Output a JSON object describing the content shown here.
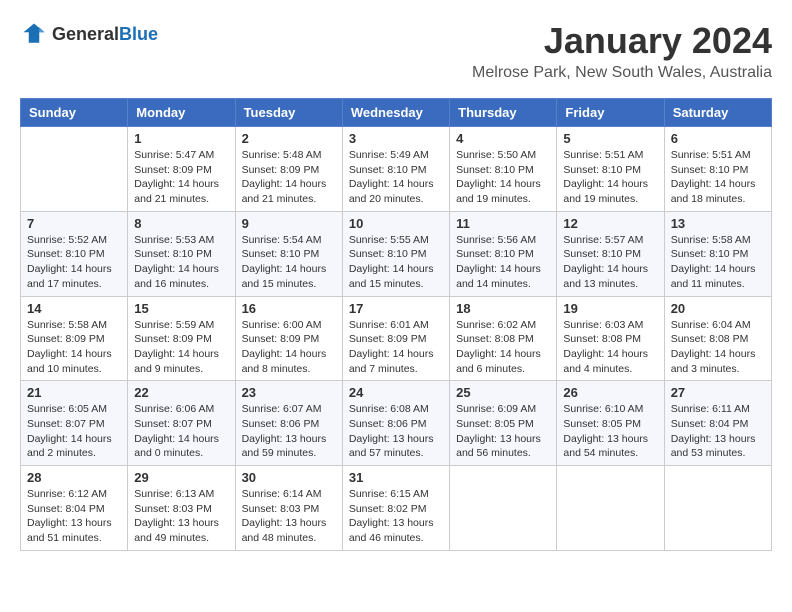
{
  "logo": {
    "general": "General",
    "blue": "Blue"
  },
  "title": {
    "month_year": "January 2024",
    "location": "Melrose Park, New South Wales, Australia"
  },
  "days_of_week": [
    "Sunday",
    "Monday",
    "Tuesday",
    "Wednesday",
    "Thursday",
    "Friday",
    "Saturday"
  ],
  "weeks": [
    [
      {
        "day": "",
        "info": ""
      },
      {
        "day": "1",
        "info": "Sunrise: 5:47 AM\nSunset: 8:09 PM\nDaylight: 14 hours\nand 21 minutes."
      },
      {
        "day": "2",
        "info": "Sunrise: 5:48 AM\nSunset: 8:09 PM\nDaylight: 14 hours\nand 21 minutes."
      },
      {
        "day": "3",
        "info": "Sunrise: 5:49 AM\nSunset: 8:10 PM\nDaylight: 14 hours\nand 20 minutes."
      },
      {
        "day": "4",
        "info": "Sunrise: 5:50 AM\nSunset: 8:10 PM\nDaylight: 14 hours\nand 19 minutes."
      },
      {
        "day": "5",
        "info": "Sunrise: 5:51 AM\nSunset: 8:10 PM\nDaylight: 14 hours\nand 19 minutes."
      },
      {
        "day": "6",
        "info": "Sunrise: 5:51 AM\nSunset: 8:10 PM\nDaylight: 14 hours\nand 18 minutes."
      }
    ],
    [
      {
        "day": "7",
        "info": "Sunrise: 5:52 AM\nSunset: 8:10 PM\nDaylight: 14 hours\nand 17 minutes."
      },
      {
        "day": "8",
        "info": "Sunrise: 5:53 AM\nSunset: 8:10 PM\nDaylight: 14 hours\nand 16 minutes."
      },
      {
        "day": "9",
        "info": "Sunrise: 5:54 AM\nSunset: 8:10 PM\nDaylight: 14 hours\nand 15 minutes."
      },
      {
        "day": "10",
        "info": "Sunrise: 5:55 AM\nSunset: 8:10 PM\nDaylight: 14 hours\nand 15 minutes."
      },
      {
        "day": "11",
        "info": "Sunrise: 5:56 AM\nSunset: 8:10 PM\nDaylight: 14 hours\nand 14 minutes."
      },
      {
        "day": "12",
        "info": "Sunrise: 5:57 AM\nSunset: 8:10 PM\nDaylight: 14 hours\nand 13 minutes."
      },
      {
        "day": "13",
        "info": "Sunrise: 5:58 AM\nSunset: 8:10 PM\nDaylight: 14 hours\nand 11 minutes."
      }
    ],
    [
      {
        "day": "14",
        "info": "Sunrise: 5:58 AM\nSunset: 8:09 PM\nDaylight: 14 hours\nand 10 minutes."
      },
      {
        "day": "15",
        "info": "Sunrise: 5:59 AM\nSunset: 8:09 PM\nDaylight: 14 hours\nand 9 minutes."
      },
      {
        "day": "16",
        "info": "Sunrise: 6:00 AM\nSunset: 8:09 PM\nDaylight: 14 hours\nand 8 minutes."
      },
      {
        "day": "17",
        "info": "Sunrise: 6:01 AM\nSunset: 8:09 PM\nDaylight: 14 hours\nand 7 minutes."
      },
      {
        "day": "18",
        "info": "Sunrise: 6:02 AM\nSunset: 8:08 PM\nDaylight: 14 hours\nand 6 minutes."
      },
      {
        "day": "19",
        "info": "Sunrise: 6:03 AM\nSunset: 8:08 PM\nDaylight: 14 hours\nand 4 minutes."
      },
      {
        "day": "20",
        "info": "Sunrise: 6:04 AM\nSunset: 8:08 PM\nDaylight: 14 hours\nand 3 minutes."
      }
    ],
    [
      {
        "day": "21",
        "info": "Sunrise: 6:05 AM\nSunset: 8:07 PM\nDaylight: 14 hours\nand 2 minutes."
      },
      {
        "day": "22",
        "info": "Sunrise: 6:06 AM\nSunset: 8:07 PM\nDaylight: 14 hours\nand 0 minutes."
      },
      {
        "day": "23",
        "info": "Sunrise: 6:07 AM\nSunset: 8:06 PM\nDaylight: 13 hours\nand 59 minutes."
      },
      {
        "day": "24",
        "info": "Sunrise: 6:08 AM\nSunset: 8:06 PM\nDaylight: 13 hours\nand 57 minutes."
      },
      {
        "day": "25",
        "info": "Sunrise: 6:09 AM\nSunset: 8:05 PM\nDaylight: 13 hours\nand 56 minutes."
      },
      {
        "day": "26",
        "info": "Sunrise: 6:10 AM\nSunset: 8:05 PM\nDaylight: 13 hours\nand 54 minutes."
      },
      {
        "day": "27",
        "info": "Sunrise: 6:11 AM\nSunset: 8:04 PM\nDaylight: 13 hours\nand 53 minutes."
      }
    ],
    [
      {
        "day": "28",
        "info": "Sunrise: 6:12 AM\nSunset: 8:04 PM\nDaylight: 13 hours\nand 51 minutes."
      },
      {
        "day": "29",
        "info": "Sunrise: 6:13 AM\nSunset: 8:03 PM\nDaylight: 13 hours\nand 49 minutes."
      },
      {
        "day": "30",
        "info": "Sunrise: 6:14 AM\nSunset: 8:03 PM\nDaylight: 13 hours\nand 48 minutes."
      },
      {
        "day": "31",
        "info": "Sunrise: 6:15 AM\nSunset: 8:02 PM\nDaylight: 13 hours\nand 46 minutes."
      },
      {
        "day": "",
        "info": ""
      },
      {
        "day": "",
        "info": ""
      },
      {
        "day": "",
        "info": ""
      }
    ]
  ]
}
